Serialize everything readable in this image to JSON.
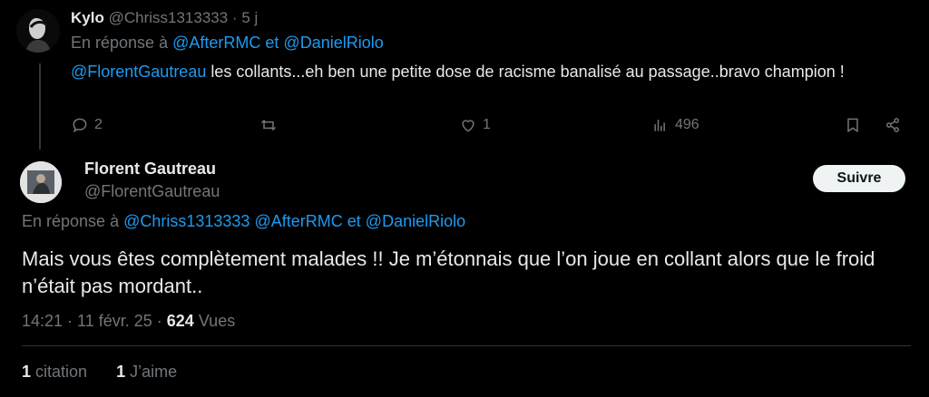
{
  "reply": {
    "author_name": "Kylo",
    "author_handle": "@Chriss1313333",
    "separator": "·",
    "age": "5 j",
    "reply_prefix": "En réponse à",
    "reply_to_1": "@AfterRMC",
    "reply_and": "et",
    "reply_to_2": "@DanielRiolo",
    "mention": "@FlorentGautreau",
    "text": " les collants...eh ben une petite dose de racisme banalisé au passage..bravo champion !",
    "actions": {
      "reply_count": "2",
      "retweet_count": "",
      "like_count": "1",
      "view_count": "496"
    }
  },
  "main": {
    "author_name": "Florent Gautreau",
    "author_handle": "@FlorentGautreau",
    "follow_label": "Suivre",
    "reply_prefix": "En réponse à",
    "reply_to_1": "@Chriss1313333",
    "reply_to_2": "@AfterRMC",
    "reply_and": "et",
    "reply_to_3": "@DanielRiolo",
    "text": "Mais vous êtes complètement malades !! Je m’étonnais que l’on joue en collant alors que le froid n’était pas mordant..",
    "time": "14:21 · 11 févr. 25 ·",
    "views_count": "624",
    "views_label": "Vues",
    "quotes_count": "1",
    "quotes_label": "citation",
    "likes_count": "1",
    "likes_label": "J’aime"
  },
  "colors": {
    "accent": "#1d9bf0",
    "muted": "#71767b",
    "text": "#e7e9ea"
  },
  "icons": [
    "reply-icon",
    "retweet-icon",
    "like-icon",
    "views-icon",
    "bookmark-icon",
    "share-icon"
  ]
}
